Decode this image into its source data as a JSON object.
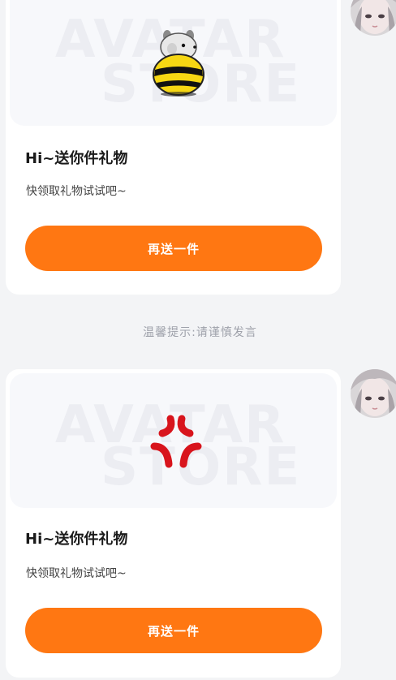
{
  "gift_cards": [
    {
      "title": "Hi~送你件礼物",
      "subtitle": "快领取礼物试试吧~",
      "button_label": "再送一件",
      "watermark_line1": "AVATAR",
      "watermark_line2": "STORE",
      "gift_icon": "bee-hamster-icon"
    },
    {
      "title": "Hi~送你件礼物",
      "subtitle": "快领取礼物试试吧~",
      "button_label": "再送一件",
      "watermark_line1": "AVATAR",
      "watermark_line2": "STORE",
      "gift_icon": "anger-symbol-icon"
    }
  ],
  "tip": "温馨提示:请谨慎发言",
  "colors": {
    "accent": "#ff7712",
    "card_background": "#ffffff",
    "page_background": "#f3f4f6",
    "anger_symbol": "#d8141c",
    "bee_yellow": "#f6d713"
  }
}
